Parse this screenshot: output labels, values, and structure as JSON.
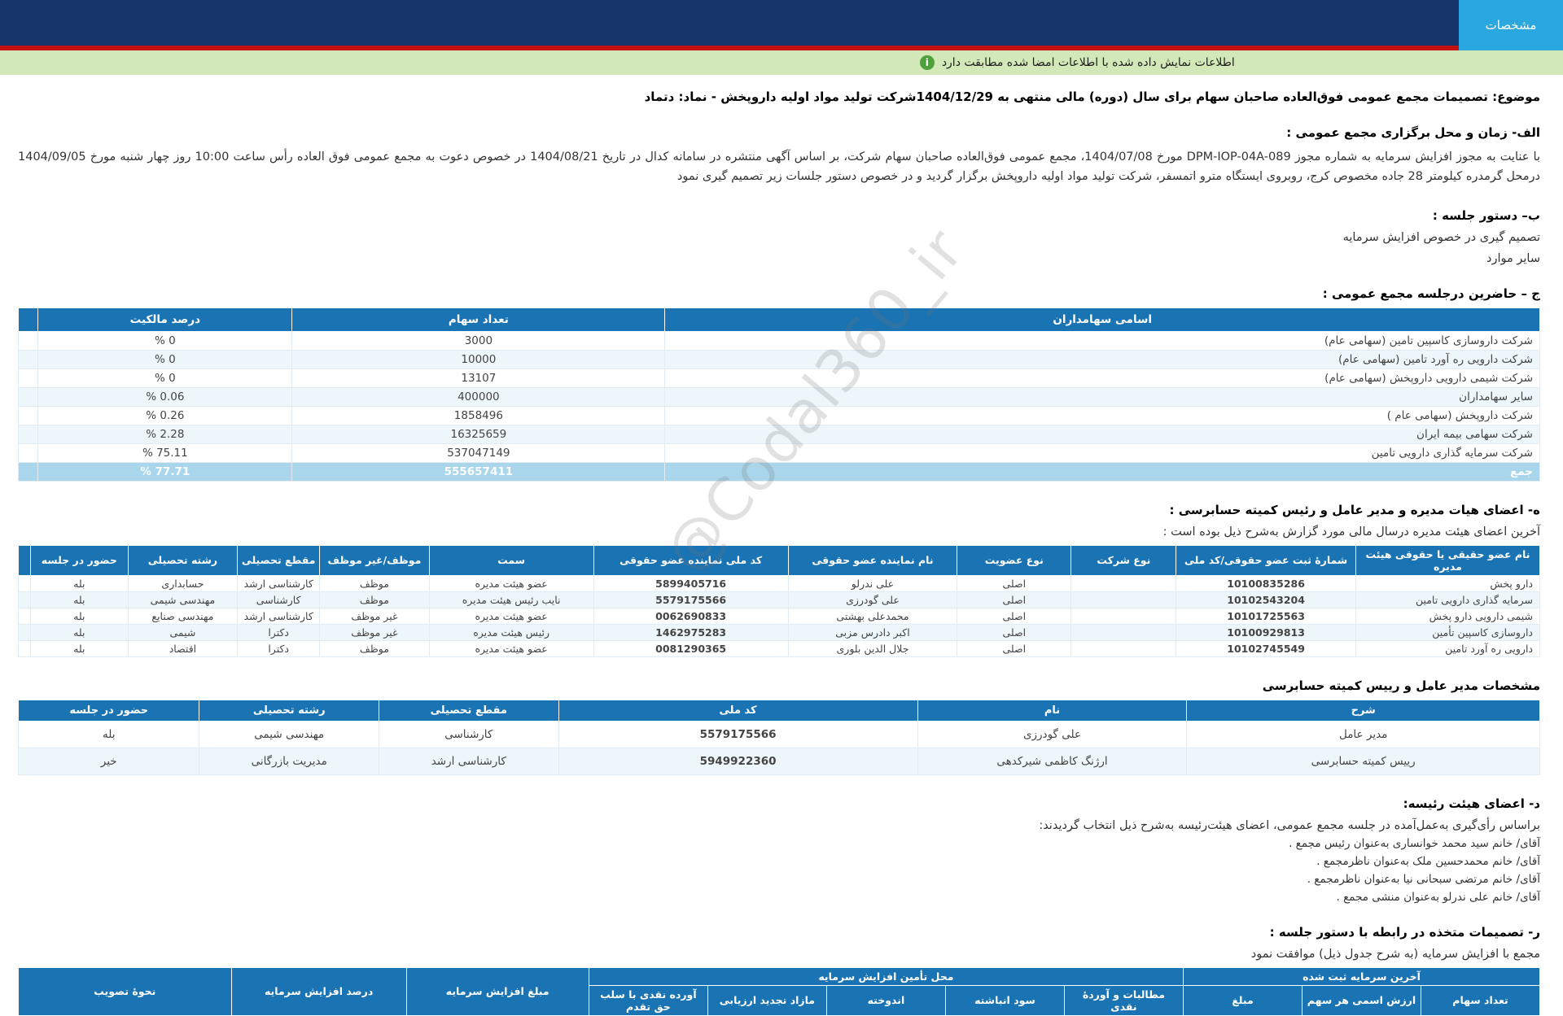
{
  "header": {
    "tab_label": "مشخصات"
  },
  "notice": {
    "text": "اطلاعات نمایش داده شده با اطلاعات امضا شده مطابقت دارد"
  },
  "watermark": "@Codal360_ir",
  "colors": {
    "header_navy": "#17356b",
    "accent_red": "#c41212",
    "tab_blue": "#2aa7df",
    "notice_green_bg": "#d3e8b8",
    "table_header_blue": "#1a73b3",
    "total_row_blue": "#a9d6eb"
  },
  "subject": "موضوع: تصمیمات مجمع عمومی فوق‌العاده صاحبان سهام برای سال (دوره) مالی منتهی به 1404/12/29شرکت تولید مواد اولیه داروپخش - نماد: دتماد",
  "sections": {
    "a": {
      "heading": "الف- زمان و محل برگزاری مجمع عمومی :",
      "body": "با عنایت به مجوز افزایش سرمایه به شماره مجوز DPM-IOP-04A-089 مورخ 1404/07/08، مجمع عمومی فوق‌العاده صاحبان سهام شرکت، بر اساس آگهی منتشره در سامانه کدال در تاریخ 1404/08/21 در خصوص دعوت به مجمع عمومی فوق العاده رأس ساعت 10:00 روز چهار شنبه مورخ 1404/09/05 درمحل گرمدره کیلومتر 28 جاده مخصوص کرج، روبروی ایستگاه مترو اتمسفر، شرکت تولید مواد اولیه داروپخش برگزار گردید و در خصوص دستور جلسات زیر تصمیم گیری نمود"
    },
    "b": {
      "heading": "ب– دستور جلسه :",
      "items": [
        "تصمیم گیری در خصوص افزایش سرمایه",
        "سایر موارد"
      ]
    },
    "c": {
      "heading": "ج – حاضرین درجلسه مجمع عمومی :"
    },
    "e": {
      "heading": "ه- اعضای هیات مدیره و مدیر عامل و رئیس کمیته حسابرسی :",
      "subtitle": "آخرین اعضای هیئت مدیره درسال مالی مورد گزارش به‌شرح ذیل بوده است :"
    },
    "manager": {
      "heading": "مشخصات مدیر عامل و رییس کمیته حسابرسی"
    },
    "d": {
      "heading": "د- اعضای هیئت رئیسه:",
      "subtitle": "براساس رأی‌گیری به‌عمل‌آمده در جلسه مجمع عمومی، اعضای هیئت‌رئیسه به‌شرح ذیل انتخاب گردیدند:",
      "members": [
        "آقای/ خانم  سید محمد خوانساری  به‌عنوان رئیس مجمع .",
        "آقای/ خانم  محمدحسین ملک  به‌عنوان ناظرمجمع .",
        "آقای/ خانم  مرتضی سبحانی نیا  به‌عنوان ناظرمجمع .",
        "آقای/ خانم  علی  ندرلو  به‌عنوان منشی مجمع ."
      ]
    },
    "r": {
      "heading": "ر- تصمیمات متخذه در رابطه با دستور جلسه :",
      "subtitle": "مجمع با افزایش سرمایه (به شرح جدول ذیل) موافقت نمود"
    }
  },
  "attendees_table": {
    "col_shareholders": "اسامی سهامداران",
    "col_shares": "تعداد سهام",
    "col_percent": "درصد مالکیت",
    "rows": [
      {
        "name": "شرکت داروسازی کاسپین تامین (سهامی عام)",
        "shares": "3000",
        "percent": "% 0"
      },
      {
        "name": "شرکت دارویی ره آورد تامین (سهامی عام)",
        "shares": "10000",
        "percent": "% 0"
      },
      {
        "name": "شرکت شیمی دارویی داروپخش (سهامی عام)",
        "shares": "13107",
        "percent": "% 0"
      },
      {
        "name": "سایر سهامداران",
        "shares": "400000",
        "percent": "% 0.06"
      },
      {
        "name": "شرکت داروپخش (سهامی عام )",
        "shares": "1858496",
        "percent": "% 0.26"
      },
      {
        "name": "شرکت سهامی بیمه ایران",
        "shares": "16325659",
        "percent": "% 2.28"
      },
      {
        "name": "شرکت سرمایه گذاری دارویی تامین",
        "shares": "537047149",
        "percent": "% 75.11"
      }
    ],
    "total": {
      "name": "جمع",
      "shares": "555657411",
      "percent": "% 77.71"
    }
  },
  "board_table": {
    "headers": [
      "نام عضو حقیقی یا حقوقی هیئت مدیره",
      "شمارهٔ ثبت عضو حقوقی/کد ملی",
      "نوع شرکت",
      "نوع عضویت",
      "نام نماینده عضو حقوقی",
      "کد ملی نماینده عضو حقوقی",
      "سمت",
      "موظف/غیر موظف",
      "مقطع تحصیلی",
      "رشته تحصیلی",
      "حضور در جلسه"
    ],
    "rows": [
      [
        "دارو پخش",
        "10100835286",
        "",
        "اصلی",
        "علی ندرلو",
        "5899405716",
        "عضو هیئت مدیره",
        "موظف",
        "کارشناسی ارشد",
        "حسابداری",
        "بله"
      ],
      [
        "سرمایه گذاری دارویی تامین",
        "10102543204",
        "",
        "اصلی",
        "علی گودرزی",
        "5579175566",
        "نایب رئیس هیئت مدیره",
        "موظف",
        "کارشناسی",
        "مهندسی شیمی",
        "بله"
      ],
      [
        "شیمی دارویی دارو پخش",
        "10101725563",
        "",
        "اصلی",
        "محمدعلی بهشتی",
        "0062690833",
        "عضو هیئت مدیره",
        "غیر موظف",
        "کارشناسی ارشد",
        "مهندسی صنایع",
        "بله"
      ],
      [
        "داروسازی کاسپین تأمین",
        "10100929813",
        "",
        "اصلی",
        "اکبر دادرس مزبی",
        "1462975283",
        "رئیس هیئت مدیره",
        "غیر موظف",
        "دکترا",
        "شیمی",
        "بله"
      ],
      [
        "دارویی ره آورد تامین",
        "10102745549",
        "",
        "اصلی",
        "جلال الدین بلوری",
        "0081290365",
        "عضو هیئت مدیره",
        "موظف",
        "دکترا",
        "اقتصاد",
        "بله"
      ]
    ]
  },
  "manager_table": {
    "headers": [
      "شرح",
      "نام",
      "کد ملی",
      "مقطع تحصیلی",
      "رشته تحصیلی",
      "حضور در جلسه"
    ],
    "rows": [
      [
        "مدیر عامل",
        "علی گودرزی",
        "5579175566",
        "کارشناسی",
        "مهندسی شیمی",
        "بله"
      ],
      [
        "رییس کمیته حسابرسی",
        "ارژنگ کاظمی شیرکدهی",
        "5949922360",
        "کارشناسی ارشد",
        "مدیریت بازرگانی",
        "خیر"
      ]
    ]
  },
  "capital_table": {
    "registered_group": "آخرین سرمایه ثبت شده",
    "registered_subs": [
      "تعداد سهام",
      "ارزش اسمی هر سهم",
      "مبلغ"
    ],
    "source_group": "محل تأمین افزایش سرمایه",
    "source_subs": [
      "مطالبات و آوردهٔ نقدی",
      "سود انباشته",
      "اندوخته",
      "مازاد تجدید ارزیابی",
      "آورده نقدی با سلب حق تقدم"
    ],
    "col_amount": "مبلغ افزایش سرمایه",
    "col_percent": "درصد افزایش سرمایه",
    "col_approval": "نحوهٔ تصویب"
  }
}
